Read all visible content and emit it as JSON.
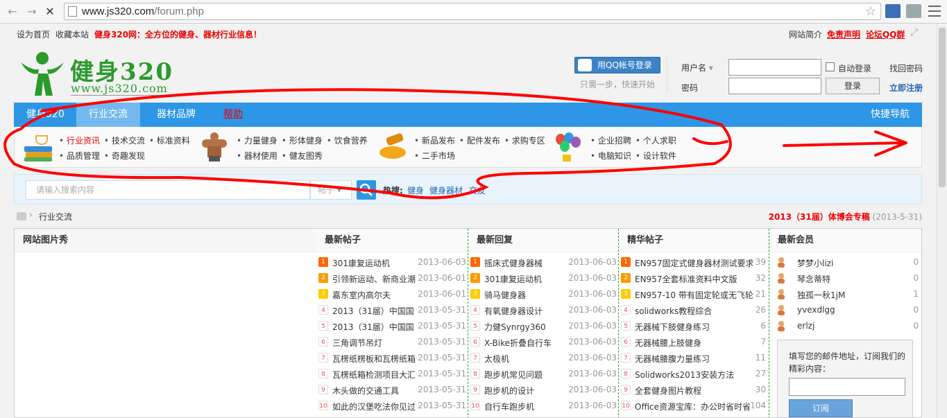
{
  "browser": {
    "url_host": "www.js320.com",
    "url_path": "/forum.php"
  },
  "topbar": {
    "set_home": "设为首页",
    "bookmark": "收藏本站",
    "slogan": "健身320网：全方位的健身、器材行业信息！",
    "site_intro": "网站简介",
    "disclaimer": "免责声明",
    "qq_group": "论坛QQ群"
  },
  "logo": {
    "name": "健身320",
    "url": "www.js320.com"
  },
  "login": {
    "qq_button": "用QQ帐号登录",
    "qq_tip": "只需一步，快速开始",
    "username_label": "用户名",
    "password_label": "密码",
    "auto_login": "自动登录",
    "login_button": "登录",
    "forgot": "找回密码",
    "register": "立即注册"
  },
  "nav": {
    "items": [
      "健身320",
      "行业交流",
      "器材品牌",
      "帮助"
    ],
    "quick": "快捷导航"
  },
  "subnav": {
    "groups": [
      {
        "row1": [
          "行业资讯",
          "技术交流",
          "标准资料"
        ],
        "row2": [
          "品质管理",
          "奇趣发现"
        ]
      },
      {
        "row1": [
          "力量健身",
          "形体健身",
          "饮食营养"
        ],
        "row2": [
          "器材使用",
          "健友图秀"
        ]
      },
      {
        "row1": [
          "新品发布",
          "配件发布",
          "求购专区"
        ],
        "row2": [
          "二手市场"
        ]
      },
      {
        "row1": [
          "企业招聘",
          "个人求职"
        ],
        "row2": [
          "电脑知识",
          "设计软件"
        ]
      }
    ]
  },
  "search": {
    "placeholder": "请输入搜索内容",
    "type": "帖子",
    "hot_label": "热搜:",
    "hot": [
      "健身",
      "健身器材",
      "交友"
    ]
  },
  "breadcrumb": {
    "current": "行业交流",
    "event": "2013（31届）体博会专稿",
    "event_date": "(2013-5-31)"
  },
  "columns": {
    "gallery": "网站图片秀",
    "latest_posts": {
      "title": "最新帖子",
      "rows": [
        {
          "t": "301康复运动机",
          "d": "2013-06-03"
        },
        {
          "t": "引领新运动、新商业潮",
          "d": "2013-06-01"
        },
        {
          "t": "嘉东室内高尔夫",
          "d": "2013-06-01"
        },
        {
          "t": "2013（31届）中国国",
          "d": "2013-05-31"
        },
        {
          "t": "2013（31届）中国国",
          "d": "2013-05-31"
        },
        {
          "t": "三角调节吊灯",
          "d": "2013-05-31"
        },
        {
          "t": "瓦楞纸楞板和瓦楞纸箱",
          "d": "2013-05-31"
        },
        {
          "t": "瓦楞纸箱检测项目大汇",
          "d": "2013-05-31"
        },
        {
          "t": "木头做的交通工具",
          "d": "2013-05-31"
        },
        {
          "t": "如此的汉堡吃法你见过",
          "d": "2013-05-31"
        }
      ]
    },
    "latest_replies": {
      "title": "最新回复",
      "rows": [
        {
          "t": "摇床式健身器械",
          "d": "2013-06-03"
        },
        {
          "t": "301康复运动机",
          "d": "2013-06-03"
        },
        {
          "t": "骑马健身器",
          "d": "2013-06-03"
        },
        {
          "t": "有氧健身器设计",
          "d": "2013-06-03"
        },
        {
          "t": "力健Synrgy360",
          "d": "2013-06-03"
        },
        {
          "t": "X-Bike折叠自行车",
          "d": "2013-06-03"
        },
        {
          "t": "太极机",
          "d": "2013-06-03"
        },
        {
          "t": "跑步机常见问题",
          "d": "2013-06-03"
        },
        {
          "t": "跑步机的设计",
          "d": "2013-06-03"
        },
        {
          "t": "自行车跑步机",
          "d": "2013-06-03"
        }
      ]
    },
    "digest": {
      "title": "精华帖子",
      "rows": [
        {
          "t": "EN957固定式健身器材测试要求",
          "c": "39"
        },
        {
          "t": "EN957全套标准资料中文版",
          "c": "32"
        },
        {
          "t": "EN957-10 带有固定轮或无飞轮",
          "c": "21"
        },
        {
          "t": "solidworks教程综合",
          "c": "26"
        },
        {
          "t": "无器械下肢健身练习",
          "c": "6"
        },
        {
          "t": "无器械腰上肢健身",
          "c": "7"
        },
        {
          "t": "无器械腰腹力量练习",
          "c": "11"
        },
        {
          "t": "Solidworks2013安装方法",
          "c": "27"
        },
        {
          "t": "全套健身图片教程",
          "c": "30"
        },
        {
          "t": "Office资源宝库：办公时省时省",
          "c": "104"
        }
      ]
    },
    "members": {
      "title": "最新会员",
      "rows": [
        {
          "n": "梦梦小lizi",
          "c": "0"
        },
        {
          "n": "琴念蒂特",
          "c": "0"
        },
        {
          "n": "独孤一秋1jM",
          "c": "1"
        },
        {
          "n": "yvexdlgg",
          "c": "0"
        },
        {
          "n": "erlzj",
          "c": "0"
        }
      ]
    }
  },
  "subscribe": {
    "text": "填写您的邮件地址，订阅我们的精彩内容：",
    "button": "订阅"
  },
  "colors": {
    "nav_blue": "#2d96e6",
    "brand_green": "#2a9a2a",
    "highlight_red": "#e00000"
  }
}
